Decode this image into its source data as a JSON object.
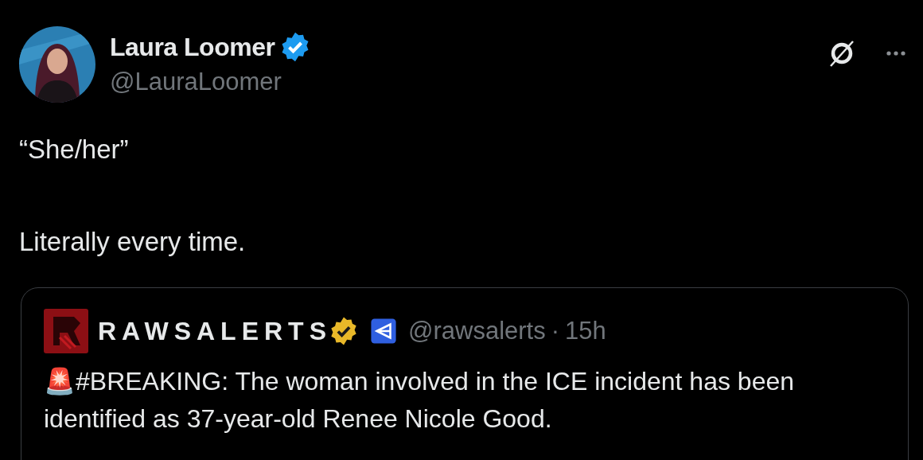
{
  "post": {
    "author": {
      "name": "Laura Loomer",
      "verified": true,
      "handle": "@LauraLoomer"
    },
    "text_lines": [
      "“She/her”",
      "Literally every time."
    ],
    "quote": {
      "author": {
        "name": "RAWSALERTS",
        "verified": true,
        "handle": "@rawsalerts",
        "separator": "·",
        "time": "15h"
      },
      "text": "🚨#BREAKING: The woman involved in the ICE incident has been identified as 37-year-old Renee Nicole Good."
    }
  }
}
